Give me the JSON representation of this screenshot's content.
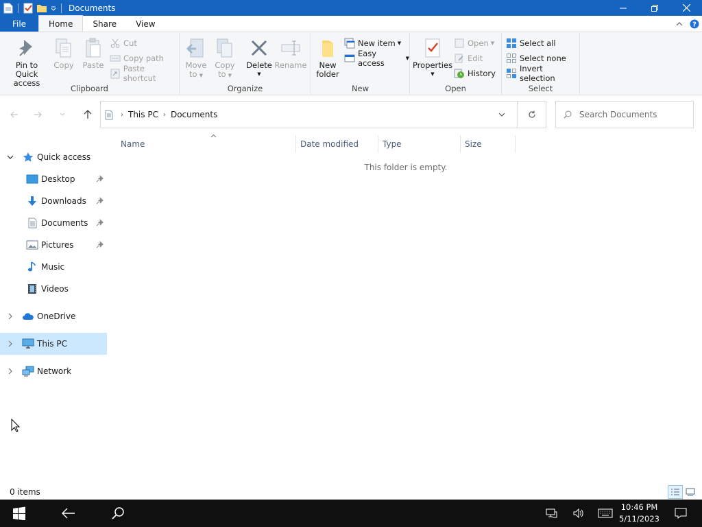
{
  "window": {
    "title": "Documents",
    "controls": {
      "minimize": "—",
      "maximize": "❐",
      "close": "✕"
    }
  },
  "tabs": {
    "file": "File",
    "home": "Home",
    "share": "Share",
    "view": "View"
  },
  "ribbon": {
    "clipboard": {
      "label": "Clipboard",
      "pin": "Pin to Quick access",
      "pin_line1": "Pin to Quick",
      "pin_line2": "access",
      "copy": "Copy",
      "paste": "Paste",
      "cut": "Cut",
      "copy_path": "Copy path",
      "paste_shortcut": "Paste shortcut"
    },
    "organize": {
      "label": "Organize",
      "move_line1": "Move",
      "move_line2": "to",
      "copy_line1": "Copy",
      "copy_line2": "to",
      "delete": "Delete",
      "rename": "Rename"
    },
    "new": {
      "label": "New",
      "folder_line1": "New",
      "folder_line2": "folder",
      "new_item": "New item",
      "easy_access": "Easy access"
    },
    "open": {
      "label": "Open",
      "properties": "Properties",
      "open": "Open",
      "edit": "Edit",
      "history": "History"
    },
    "select": {
      "label": "Select",
      "select_all": "Select all",
      "select_none": "Select none",
      "invert": "Invert selection"
    }
  },
  "address": {
    "crumbs": [
      "This PC",
      "Documents"
    ],
    "search_placeholder": "Search Documents"
  },
  "nav": {
    "quick_access": "Quick access",
    "items": [
      {
        "label": "Desktop",
        "pinned": true
      },
      {
        "label": "Downloads",
        "pinned": true
      },
      {
        "label": "Documents",
        "pinned": true
      },
      {
        "label": "Pictures",
        "pinned": true
      },
      {
        "label": "Music",
        "pinned": false
      },
      {
        "label": "Videos",
        "pinned": false
      }
    ],
    "onedrive": "OneDrive",
    "this_pc": "This PC",
    "network": "Network"
  },
  "columns": {
    "name": "Name",
    "date_modified": "Date modified",
    "type": "Type",
    "size": "Size"
  },
  "content": {
    "empty_message": "This folder is empty."
  },
  "status": {
    "item_count": "0 items"
  },
  "taskbar": {
    "time": "10:46 PM",
    "date": "5/11/2023"
  },
  "colors": {
    "title_bar": "#1565c0",
    "selection": "#cce8ff",
    "taskbar": "#101010"
  }
}
